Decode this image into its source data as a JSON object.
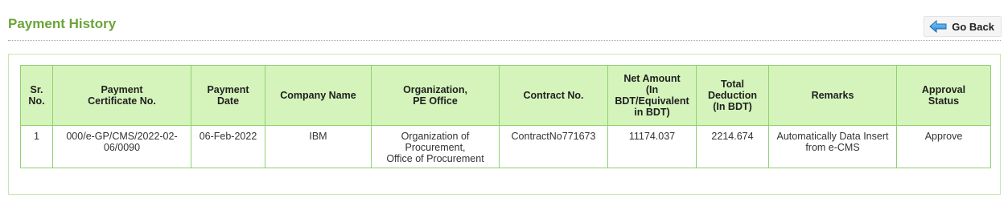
{
  "page": {
    "title": "Payment History",
    "go_back_label": "Go Back"
  },
  "colors": {
    "title": "#6aa437",
    "header_bg": "#d5f4bc",
    "border": "#8fd16f",
    "panel_border": "#c8e6b0"
  },
  "icons": {
    "go_back": "arrow-left-icon"
  },
  "table": {
    "headers": [
      "Sr.\nNo.",
      "Payment\nCertificate No.",
      "Payment\nDate",
      "Company Name",
      "Organization,\nPE Office",
      "Contract No.",
      "Net Amount\n(In\nBDT/Equivalent\nin BDT)",
      "Total\nDeduction\n(In BDT)",
      "Remarks",
      "Approval\nStatus"
    ],
    "rows": [
      {
        "sr_no": "1",
        "payment_certificate_no": "000/e-GP/CMS/2022-02-\n06/0090",
        "payment_date": "06-Feb-2022",
        "company_name": "IBM",
        "organization": "Organization of\nProcurement,\nOffice of Procurement",
        "contract_no": "ContractNo771673",
        "net_amount": "11174.037",
        "total_deduction": "2214.674",
        "remarks": "Automatically Data Insert\nfrom e-CMS",
        "approval_status": "Approve"
      }
    ]
  }
}
